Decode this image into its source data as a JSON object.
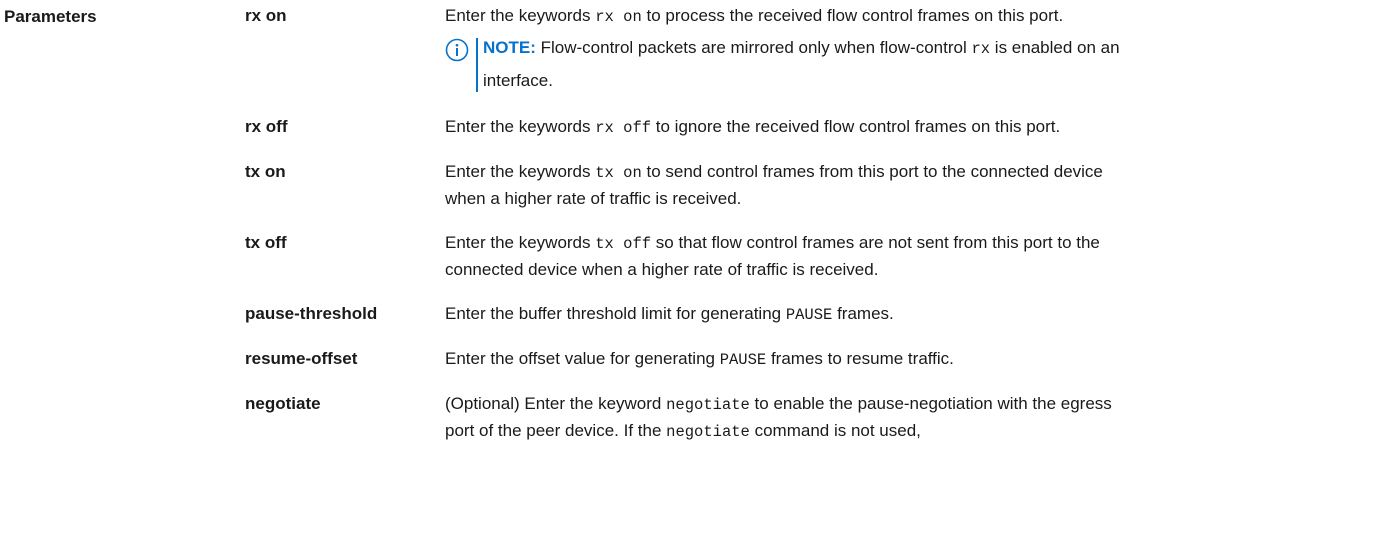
{
  "section_title": "Parameters",
  "rows": [
    {
      "name": "rx on",
      "pre": "Enter the keywords ",
      "code": "rx on",
      "post": " to process the received flow control frames on this port.",
      "note": {
        "label": "NOTE:",
        "pre": " Flow-control packets are mirrored only when flow-control ",
        "code": "rx",
        "post": " is enabled on an interface."
      }
    },
    {
      "name": "rx off",
      "pre": "Enter the keywords ",
      "code": "rx off",
      "post": " to ignore the received flow control frames on this port."
    },
    {
      "name": "tx on",
      "pre": "Enter the keywords ",
      "code": "tx on",
      "post": " to send control frames from this port to the connected device when a higher rate of traffic is received."
    },
    {
      "name": "tx off",
      "pre": "Enter the keywords ",
      "code": "tx off",
      "post": " so that flow control frames are not sent from this port to the connected device when a higher rate of traffic is received."
    },
    {
      "name": "pause-threshold",
      "pre": "Enter the buffer threshold limit for generating ",
      "code": "PAUSE",
      "post": " frames."
    },
    {
      "name": "resume-offset",
      "pre": "Enter the offset value for generating ",
      "code": "PAUSE",
      "post": " frames to resume traffic."
    },
    {
      "name": "negotiate",
      "pre": "(Optional) Enter the keyword ",
      "code": "negotiate",
      "post": " to enable the pause-negotiation with the egress port of the peer device. If the ",
      "code2": "negotiate",
      "post2": " command is not used,"
    }
  ],
  "colors": {
    "note_accent": "#0672cb",
    "text": "#1a1a1a"
  },
  "icons": {
    "note": "info-circle-icon"
  }
}
